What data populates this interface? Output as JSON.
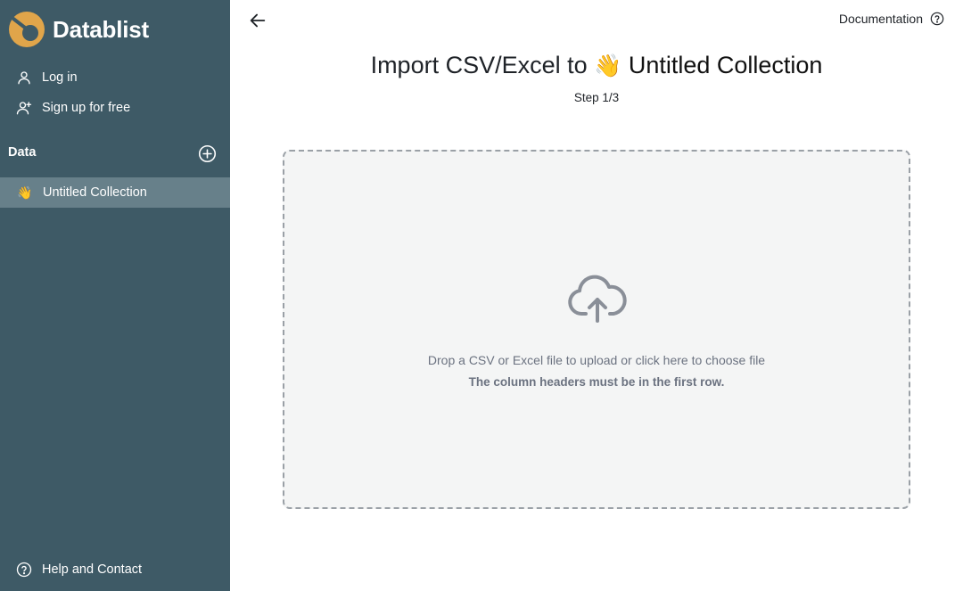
{
  "brand": {
    "name": "Datablist",
    "logo_icon": "datablist-logo-icon",
    "accent_color": "#e0a54a"
  },
  "sidebar": {
    "background_color": "#3e5a66",
    "login_label": "Log in",
    "login_icon": "user-icon",
    "signup_label": "Sign up for free",
    "signup_icon": "user-plus-icon",
    "section_label": "Data",
    "add_icon": "plus-circle-icon",
    "collections": [
      {
        "emoji": "👋",
        "label": "Untitled Collection",
        "selected": true
      }
    ],
    "help_label": "Help and Contact",
    "help_icon": "question-circle-icon"
  },
  "header": {
    "back_icon": "arrow-left-icon",
    "documentation_label": "Documentation",
    "documentation_icon": "question-circle-icon"
  },
  "import": {
    "title_prefix": "Import CSV/Excel to",
    "collection_emoji": "👋",
    "collection_name": "Untitled Collection",
    "step_label": "Step 1/3"
  },
  "dropzone": {
    "icon": "cloud-upload-icon",
    "instruction": "Drop a CSV or Excel file to upload or click here to choose file",
    "note": "The column headers must be in the first row."
  }
}
